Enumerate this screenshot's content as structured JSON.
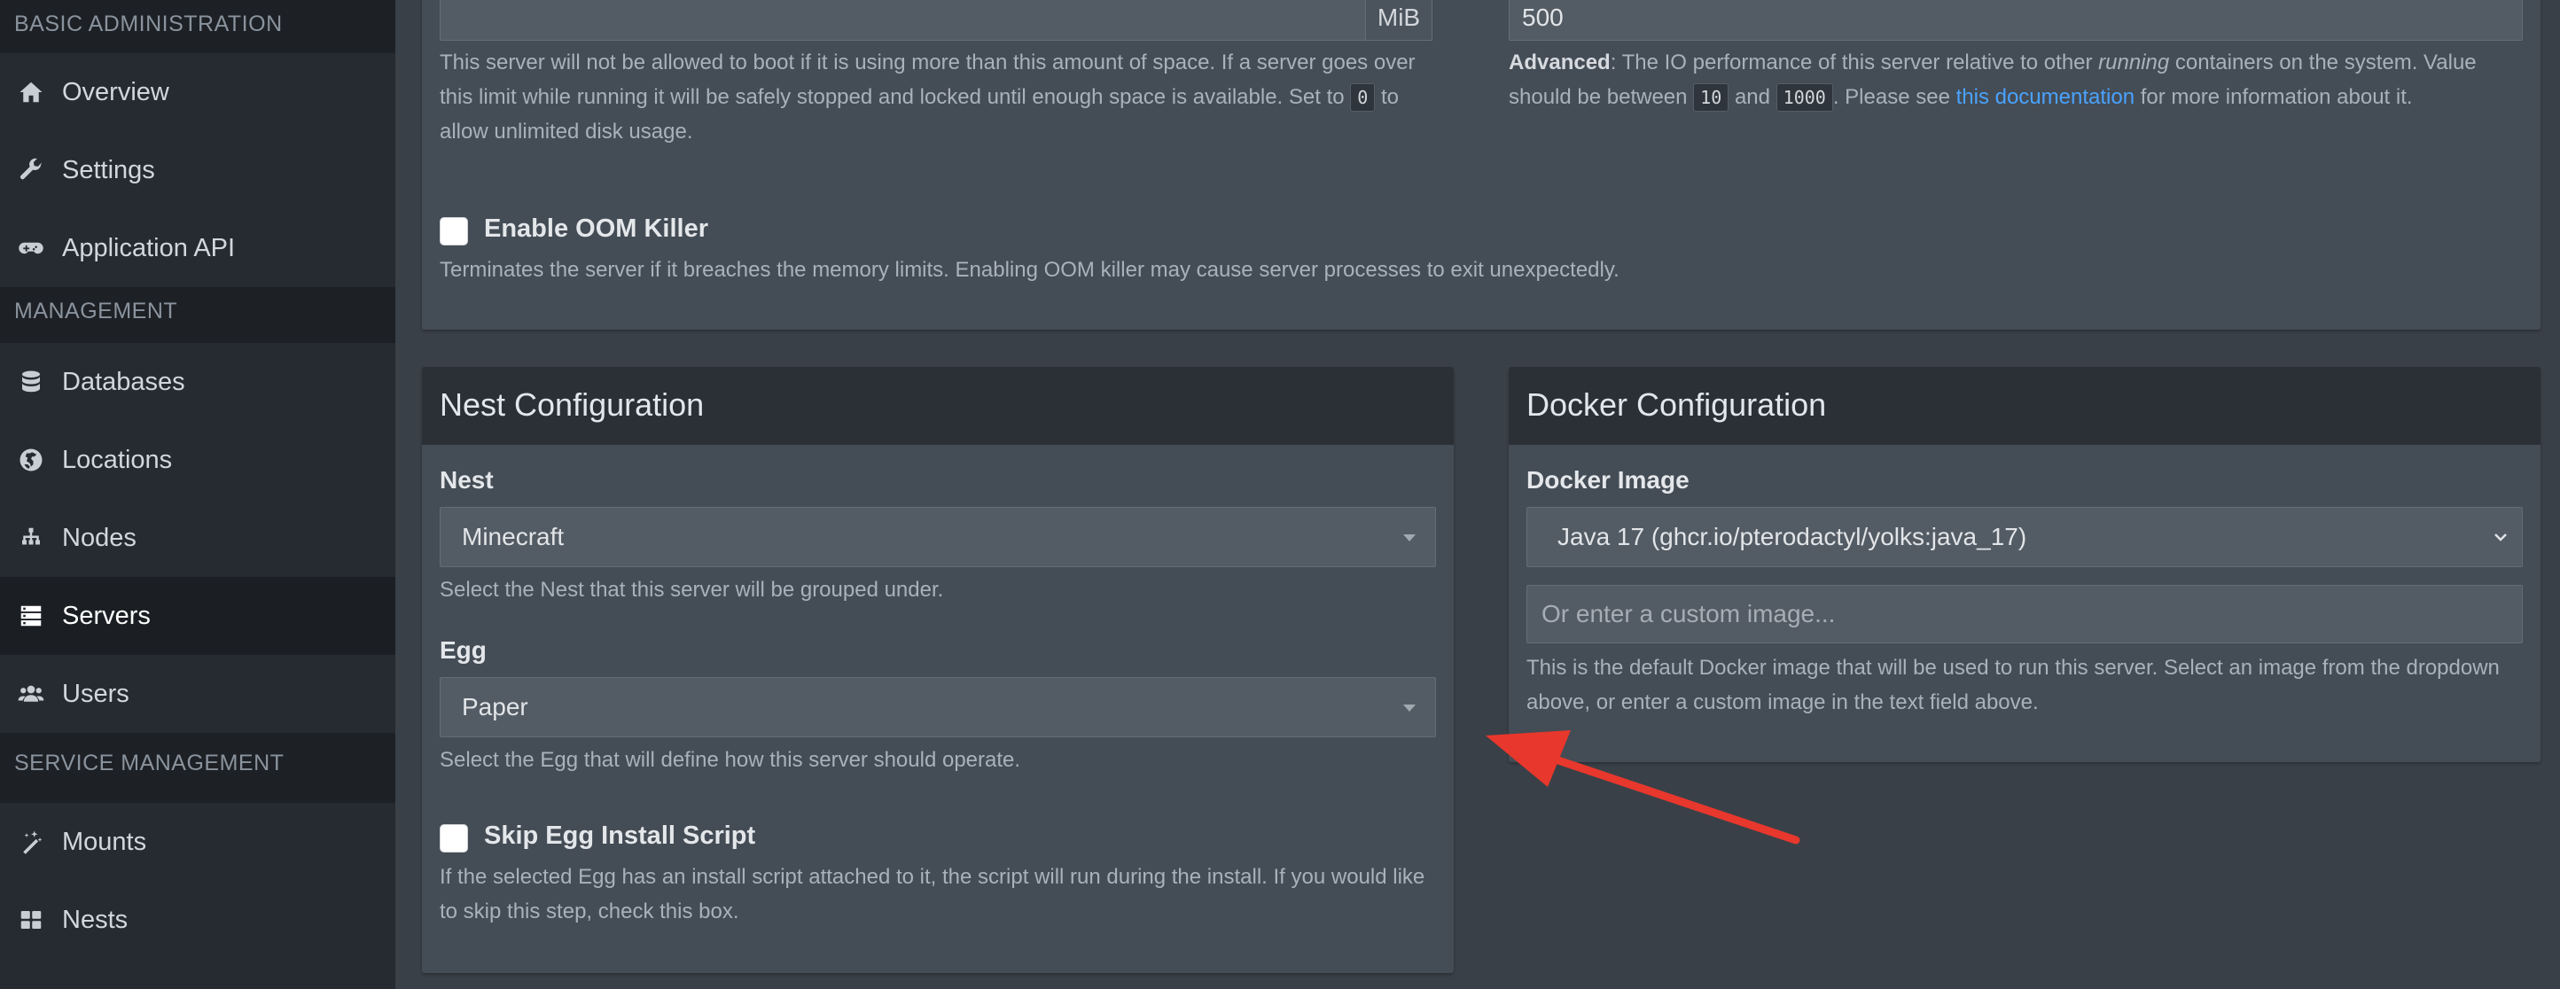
{
  "sidebar": {
    "sections": [
      {
        "header": "BASIC ADMINISTRATION",
        "items": [
          {
            "label": "Overview",
            "icon": "home-icon"
          },
          {
            "label": "Settings",
            "icon": "wrench-icon"
          },
          {
            "label": "Application API",
            "icon": "gamepad-icon"
          }
        ]
      },
      {
        "header": "MANAGEMENT",
        "items": [
          {
            "label": "Databases",
            "icon": "database-icon"
          },
          {
            "label": "Locations",
            "icon": "globe-icon"
          },
          {
            "label": "Nodes",
            "icon": "sitemap-icon"
          },
          {
            "label": "Servers",
            "icon": "server-icon",
            "active": true
          },
          {
            "label": "Users",
            "icon": "users-icon"
          }
        ]
      },
      {
        "header": "SERVICE MANAGEMENT",
        "items": [
          {
            "label": "Mounts",
            "icon": "magic-icon"
          },
          {
            "label": "Nests",
            "icon": "th-large-icon"
          }
        ]
      }
    ]
  },
  "top_panel": {
    "disk_suffix": "MiB",
    "disk_help_1": "This server will not be allowed to boot if it is using more than this amount of space. If a server goes over this limit while running it will be safely stopped and locked until enough space is available. Set to",
    "disk_help_code": "0",
    "disk_help_2": "to allow unlimited disk usage.",
    "io_value": "500",
    "io_help_bold": "Advanced",
    "io_help_1": ": The IO performance of this server relative to other",
    "io_help_em": "running",
    "io_help_2": "containers on the system. Value should be between",
    "io_code_min": "10",
    "io_help_and": "and",
    "io_code_max": "1000",
    "io_help_3": ". Please see",
    "io_help_link": "this documentation",
    "io_help_4": "for more information about it.",
    "oom_label": "Enable OOM Killer",
    "oom_help": "Terminates the server if it breaches the memory limits. Enabling OOM killer may cause server processes to exit unexpectedly."
  },
  "nest_panel": {
    "title": "Nest Configuration",
    "nest_label": "Nest",
    "nest_value": "Minecraft",
    "nest_help": "Select the Nest that this server will be grouped under.",
    "egg_label": "Egg",
    "egg_value": "Paper",
    "egg_help": "Select the Egg that will define how this server should operate.",
    "skip_label": "Skip Egg Install Script",
    "skip_help": "If the selected Egg has an install script attached to it, the script will run during the install. If you would like to skip this step, check this box."
  },
  "docker_panel": {
    "title": "Docker Configuration",
    "image_label": "Docker Image",
    "image_value": "Java 17 (ghcr.io/pterodactyl/yolks:java_17)",
    "custom_placeholder": "Or enter a custom image...",
    "help": "This is the default Docker image that will be used to run this server. Select an image from the dropdown above, or enter a custom image in the text field above."
  },
  "annotation": {
    "arrow_color": "#e8372c"
  }
}
